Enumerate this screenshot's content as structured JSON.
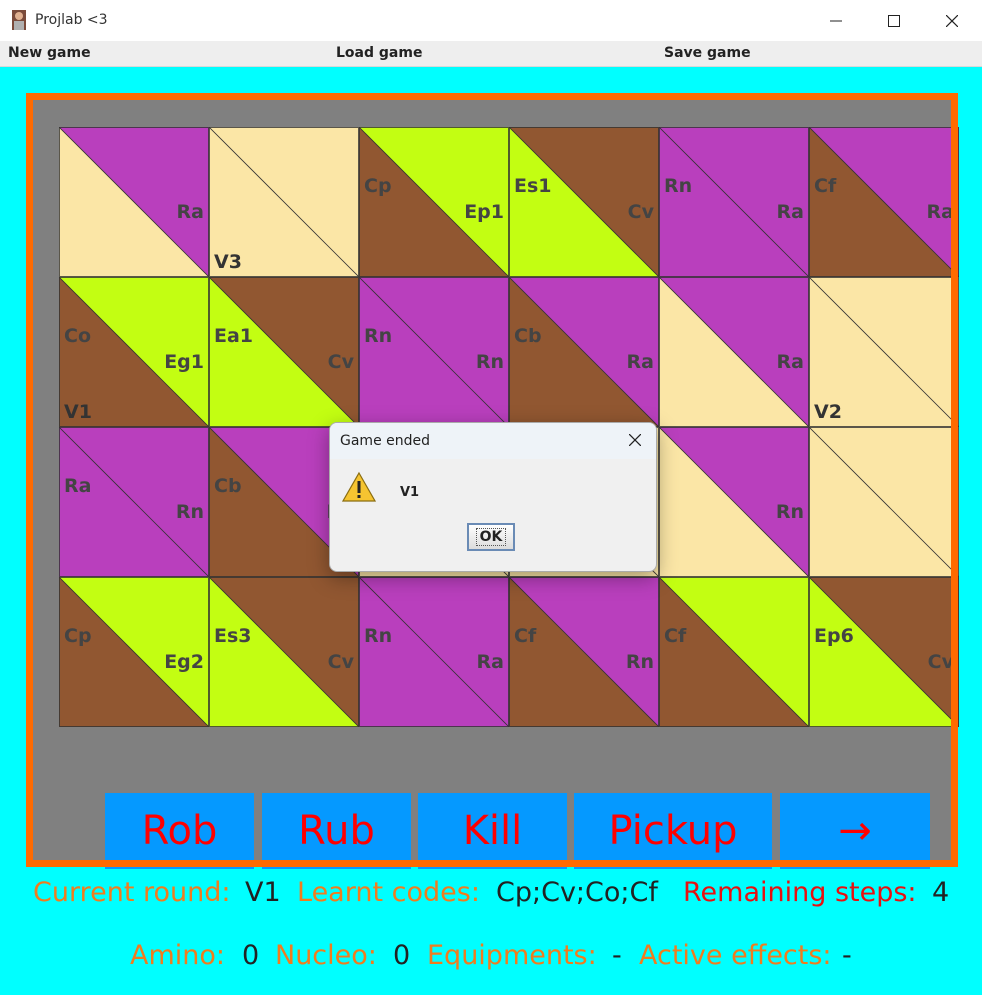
{
  "window": {
    "title": "Projlab <3"
  },
  "menu": {
    "items": [
      "New game",
      "Load game",
      "Save game"
    ]
  },
  "colors": {
    "background": "#00ffff",
    "board_border": "#ff6a00",
    "board_bg": "#808080",
    "field_colors": {
      "purple": "#b93fbd",
      "cream": "#fbe6a6",
      "lime": "#c3fe12",
      "brown": "#915731"
    },
    "action_button_bg": "#0599ff",
    "action_button_text": "#ff0000"
  },
  "board": {
    "rows": [
      [
        {
          "top_left": "",
          "bottom_right": "Ra",
          "bottom_left": "",
          "upper_color": "purple",
          "lower_color": "cream"
        },
        {
          "top_left": "",
          "bottom_right": "",
          "bottom_left": "V3",
          "upper_color": "cream",
          "lower_color": "cream"
        },
        {
          "top_left": "Cp",
          "bottom_right": "Ep1",
          "bottom_left": "",
          "upper_color": "lime",
          "lower_color": "brown"
        },
        {
          "top_left": "Es1",
          "bottom_right": "Cv",
          "bottom_left": "",
          "upper_color": "brown",
          "lower_color": "lime"
        },
        {
          "top_left": "Rn",
          "bottom_right": "Ra",
          "bottom_left": "",
          "upper_color": "purple",
          "lower_color": "purple"
        },
        {
          "top_left": "Cf",
          "bottom_right": "Ra",
          "bottom_left": "",
          "upper_color": "purple",
          "lower_color": "brown"
        }
      ],
      [
        {
          "top_left": "Co",
          "bottom_right": "Eg1",
          "bottom_left": "V1",
          "upper_color": "lime",
          "lower_color": "brown"
        },
        {
          "top_left": "Ea1",
          "bottom_right": "Cv",
          "bottom_left": "",
          "upper_color": "brown",
          "lower_color": "lime"
        },
        {
          "top_left": "Rn",
          "bottom_right": "Rn",
          "bottom_left": "",
          "upper_color": "purple",
          "lower_color": "purple"
        },
        {
          "top_left": "Cb",
          "bottom_right": "Ra",
          "bottom_left": "",
          "upper_color": "purple",
          "lower_color": "brown"
        },
        {
          "top_left": "",
          "bottom_right": "Ra",
          "bottom_left": "",
          "upper_color": "purple",
          "lower_color": "cream"
        },
        {
          "top_left": "",
          "bottom_right": "",
          "bottom_left": "V2",
          "upper_color": "cream",
          "lower_color": "cream"
        }
      ],
      [
        {
          "top_left": "Ra",
          "bottom_right": "Rn",
          "bottom_left": "",
          "upper_color": "purple",
          "lower_color": "purple"
        },
        {
          "top_left": "Cb",
          "bottom_right": "Ra",
          "bottom_left": "",
          "upper_color": "purple",
          "lower_color": "brown"
        },
        {
          "top_left": "",
          "bottom_right": "",
          "bottom_left": "",
          "upper_color": "cream",
          "lower_color": "cream"
        },
        {
          "top_left": "",
          "bottom_right": "",
          "bottom_left": "",
          "upper_color": "cream",
          "lower_color": "cream"
        },
        {
          "top_left": "",
          "bottom_right": "Rn",
          "bottom_left": "",
          "upper_color": "purple",
          "lower_color": "cream"
        },
        {
          "top_left": "",
          "bottom_right": "",
          "bottom_left": "",
          "upper_color": "cream",
          "lower_color": "cream"
        }
      ],
      [
        {
          "top_left": "Cp",
          "bottom_right": "Eg2",
          "bottom_left": "",
          "upper_color": "lime",
          "lower_color": "brown"
        },
        {
          "top_left": "Es3",
          "bottom_right": "Cv",
          "bottom_left": "",
          "upper_color": "brown",
          "lower_color": "lime"
        },
        {
          "top_left": "Rn",
          "bottom_right": "Ra",
          "bottom_left": "",
          "upper_color": "purple",
          "lower_color": "purple"
        },
        {
          "top_left": "Cf",
          "bottom_right": "Rn",
          "bottom_left": "",
          "upper_color": "purple",
          "lower_color": "brown"
        },
        {
          "top_left": "Cf",
          "bottom_right": "",
          "bottom_left": "",
          "upper_color": "lime",
          "lower_color": "brown"
        },
        {
          "top_left": "Ep6",
          "bottom_right": "Cv",
          "bottom_left": "",
          "upper_color": "brown",
          "lower_color": "lime"
        }
      ]
    ]
  },
  "actions": [
    "Rob",
    "Rub",
    "Kill",
    "Pickup",
    "→"
  ],
  "status": {
    "current_round_label": "Current round:",
    "current_round_value": "V1",
    "learnt_codes_label": "Learnt codes:",
    "learnt_codes_value": "Cp;Cv;Co;Cf",
    "remaining_steps_label": "Remaining steps:",
    "remaining_steps_value": "4",
    "amino_label": "Amino:",
    "amino_value": "0",
    "nucleo_label": "Nucleo:",
    "nucleo_value": "0",
    "equipments_label": "Equipments:",
    "equipments_value": "-",
    "active_effects_label": "Active effects:",
    "active_effects_value": "-"
  },
  "dialog": {
    "title": "Game ended",
    "message": "V1",
    "ok_label": "OK",
    "icon": "warning-icon"
  }
}
